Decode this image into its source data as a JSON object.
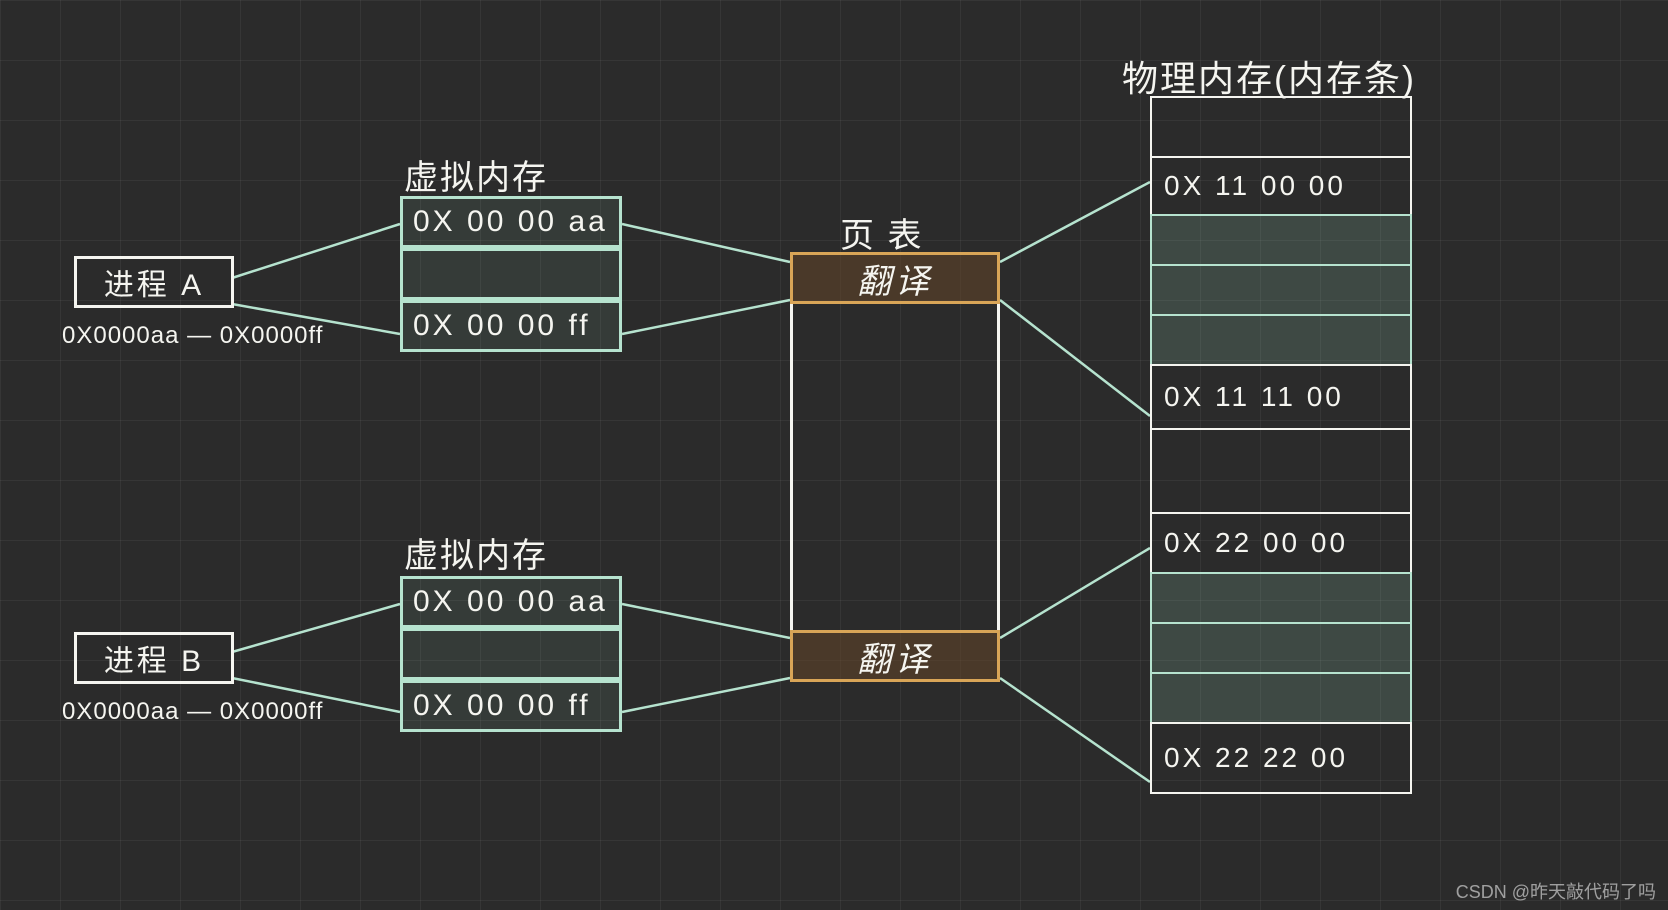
{
  "processA": {
    "title": "进程 A",
    "range": "0X0000aa — 0X0000ff",
    "vmem_title": "虚拟内存",
    "vmem_top": "0X 00 00 aa",
    "vmem_bottom": "0X 00 00 ff"
  },
  "processB": {
    "title": "进程 B",
    "range": "0X0000aa — 0X0000ff",
    "vmem_title": "虚拟内存",
    "vmem_top": "0X 00 00 aa",
    "vmem_bottom": "0X 00 00 ff"
  },
  "page_table": {
    "title": "页 表",
    "translate_top": "翻译",
    "translate_bottom": "翻译"
  },
  "physical_memory": {
    "title": "物理内存(内存条)",
    "cells": {
      "c1": "",
      "c2": "0X 11 00 00",
      "c3": "",
      "c4": "",
      "c5": "",
      "c6": "0X  11 11  00",
      "c7": "",
      "c8": "0X 22 00 00",
      "c9": "",
      "c10": "",
      "c11": "",
      "c12": "0X 22 22 00"
    }
  },
  "watermark": "CSDN @昨天敲代码了吗"
}
